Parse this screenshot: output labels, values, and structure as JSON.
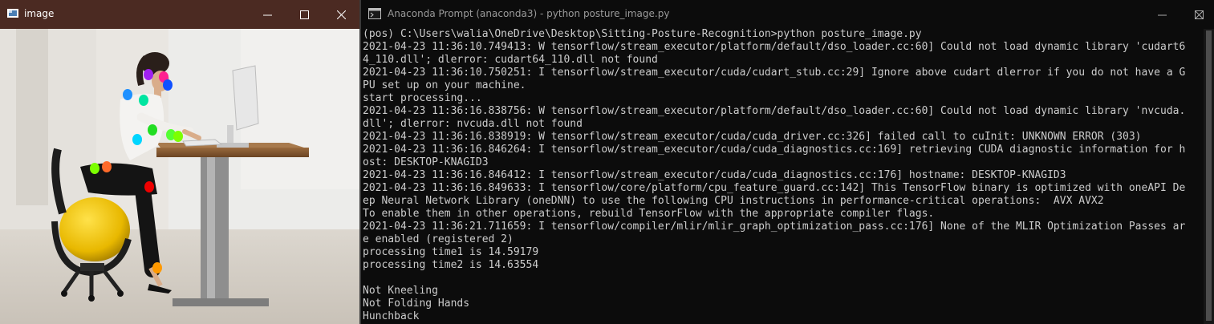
{
  "left_window": {
    "title": "image",
    "icon": "image-window-icon",
    "keypoint_colors": [
      "#a020f0",
      "#ff2090",
      "#1050ff",
      "#1e90ff",
      "#00e5a0",
      "#22dd22",
      "#00d5ff",
      "#55ff33",
      "#7cff00",
      "#ff6a2a",
      "#ee0000",
      "#ff9900"
    ]
  },
  "right_window": {
    "title": "Anaconda Prompt (anaconda3) - python  posture_image.py",
    "icon": "terminal-icon",
    "console_lines": [
      "(pos) C:\\Users\\walia\\OneDrive\\Desktop\\Sitting-Posture-Recognition>python posture_image.py",
      "2021-04-23 11:36:10.749413: W tensorflow/stream_executor/platform/default/dso_loader.cc:60] Could not load dynamic library 'cudart6",
      "4_110.dll'; dlerror: cudart64_110.dll not found",
      "2021-04-23 11:36:10.750251: I tensorflow/stream_executor/cuda/cudart_stub.cc:29] Ignore above cudart dlerror if you do not have a G",
      "PU set up on your machine.",
      "start processing...",
      "2021-04-23 11:36:16.838756: W tensorflow/stream_executor/platform/default/dso_loader.cc:60] Could not load dynamic library 'nvcuda.",
      "dll'; dlerror: nvcuda.dll not found",
      "2021-04-23 11:36:16.838919: W tensorflow/stream_executor/cuda/cuda_driver.cc:326] failed call to cuInit: UNKNOWN ERROR (303)",
      "2021-04-23 11:36:16.846264: I tensorflow/stream_executor/cuda/cuda_diagnostics.cc:169] retrieving CUDA diagnostic information for h",
      "ost: DESKTOP-KNAGID3",
      "2021-04-23 11:36:16.846412: I tensorflow/stream_executor/cuda/cuda_diagnostics.cc:176] hostname: DESKTOP-KNAGID3",
      "2021-04-23 11:36:16.849633: I tensorflow/core/platform/cpu_feature_guard.cc:142] This TensorFlow binary is optimized with oneAPI De",
      "ep Neural Network Library (oneDNN) to use the following CPU instructions in performance-critical operations:  AVX AVX2",
      "To enable them in other operations, rebuild TensorFlow with the appropriate compiler flags.",
      "2021-04-23 11:36:21.711659: I tensorflow/compiler/mlir/mlir_graph_optimization_pass.cc:176] None of the MLIR Optimization Passes ar",
      "e enabled (registered 2)",
      "processing time1 is 14.59179",
      "processing time2 is 14.63554",
      "",
      "Not Kneeling",
      "Not Folding Hands",
      "Hunchback"
    ]
  }
}
